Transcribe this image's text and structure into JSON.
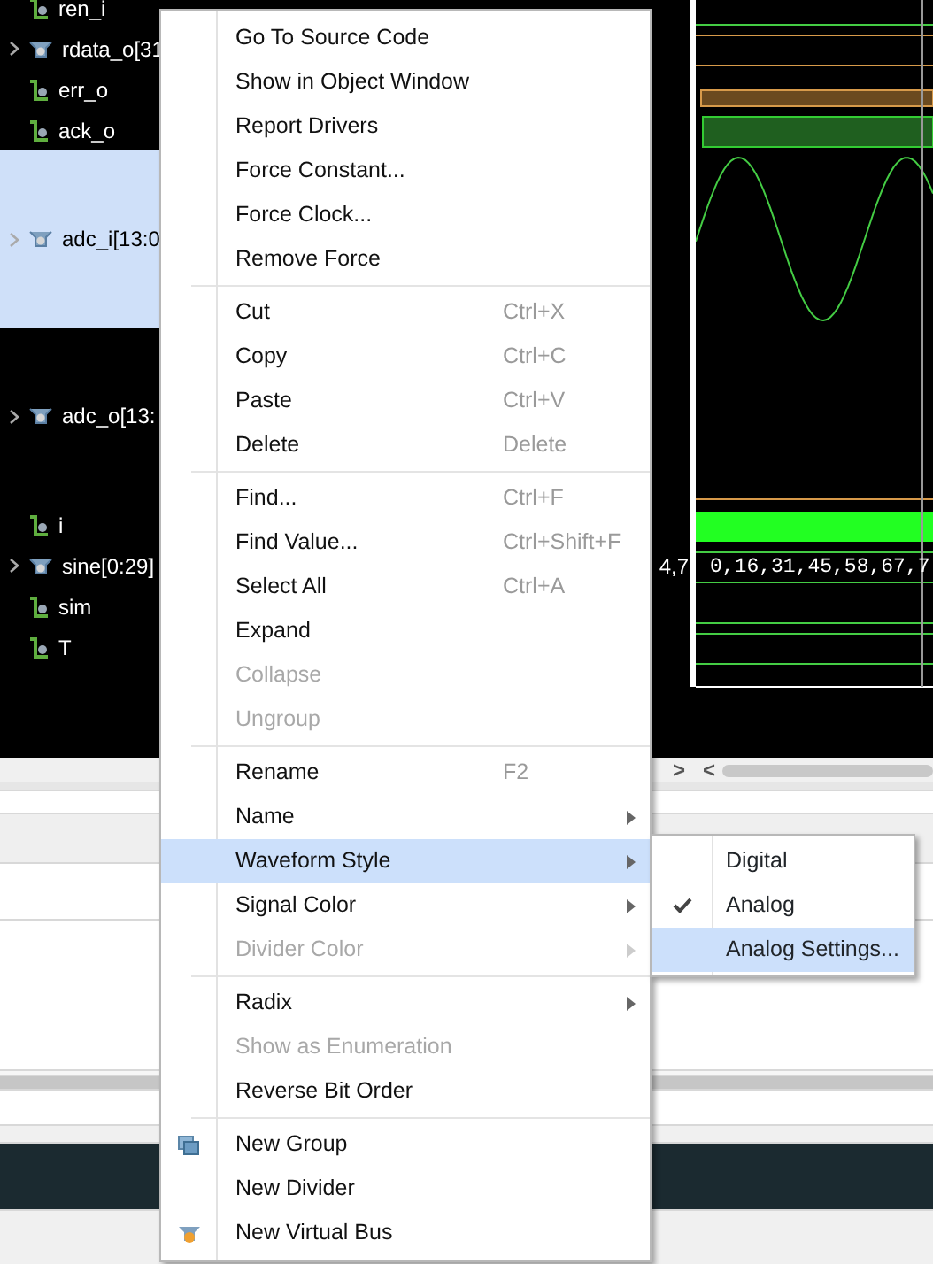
{
  "signals": [
    {
      "name": "ren_i",
      "kind": "bit",
      "expandable": false,
      "selected": false
    },
    {
      "name": "rdata_o[31",
      "kind": "bus",
      "expandable": true,
      "selected": false
    },
    {
      "name": "err_o",
      "kind": "bit",
      "expandable": false,
      "selected": false
    },
    {
      "name": "ack_o",
      "kind": "bit",
      "expandable": false,
      "selected": false
    },
    {
      "name": "adc_i[13:0",
      "kind": "analog",
      "expandable": true,
      "selected": true
    },
    {
      "name": "adc_o[13:",
      "kind": "analog",
      "expandable": true,
      "selected": false
    },
    {
      "name": "i",
      "kind": "bit",
      "expandable": false,
      "selected": false
    },
    {
      "name": "sine[0:29]",
      "kind": "bus",
      "expandable": true,
      "selected": false,
      "value": "4,7",
      "wave_text": "0,16,31,45,58,67,7"
    },
    {
      "name": "sim",
      "kind": "bit",
      "expandable": false,
      "selected": false
    },
    {
      "name": "T",
      "kind": "bit",
      "expandable": false,
      "selected": false
    }
  ],
  "scroll": {
    "left": ">",
    "right": "<"
  },
  "menu": [
    {
      "kind": "item",
      "label": "Go To Source Code",
      "disabled": false,
      "submenu": false,
      "selected": false
    },
    {
      "kind": "item",
      "label": "Show in Object Window",
      "disabled": false,
      "submenu": false,
      "selected": false
    },
    {
      "kind": "item",
      "label": "Report Drivers",
      "disabled": false,
      "submenu": false,
      "selected": false
    },
    {
      "kind": "item",
      "label": "Force Constant...",
      "disabled": false,
      "submenu": false,
      "selected": false
    },
    {
      "kind": "item",
      "label": "Force Clock...",
      "disabled": false,
      "submenu": false,
      "selected": false
    },
    {
      "kind": "item",
      "label": "Remove Force",
      "disabled": false,
      "submenu": false,
      "selected": false
    },
    {
      "kind": "separator"
    },
    {
      "kind": "item",
      "label": "Cut",
      "shortcut": "Ctrl+X",
      "disabled": false,
      "submenu": false,
      "selected": false
    },
    {
      "kind": "item",
      "label": "Copy",
      "shortcut": "Ctrl+C",
      "disabled": false,
      "submenu": false,
      "selected": false
    },
    {
      "kind": "item",
      "label": "Paste",
      "shortcut": "Ctrl+V",
      "disabled": false,
      "submenu": false,
      "selected": false
    },
    {
      "kind": "item",
      "label": "Delete",
      "shortcut": "Delete",
      "disabled": false,
      "submenu": false,
      "selected": false
    },
    {
      "kind": "separator"
    },
    {
      "kind": "item",
      "label": "Find...",
      "shortcut": "Ctrl+F",
      "disabled": false,
      "submenu": false,
      "selected": false
    },
    {
      "kind": "item",
      "label": "Find Value...",
      "shortcut": "Ctrl+Shift+F",
      "disabled": false,
      "submenu": false,
      "selected": false
    },
    {
      "kind": "item",
      "label": "Select All",
      "shortcut": "Ctrl+A",
      "disabled": false,
      "submenu": false,
      "selected": false
    },
    {
      "kind": "item",
      "label": "Expand",
      "disabled": false,
      "submenu": false,
      "selected": false
    },
    {
      "kind": "item",
      "label": "Collapse",
      "disabled": true,
      "submenu": false,
      "selected": false
    },
    {
      "kind": "item",
      "label": "Ungroup",
      "disabled": true,
      "submenu": false,
      "selected": false
    },
    {
      "kind": "separator"
    },
    {
      "kind": "item",
      "label": "Rename",
      "shortcut": "F2",
      "disabled": false,
      "submenu": false,
      "selected": false
    },
    {
      "kind": "item",
      "label": "Name",
      "disabled": false,
      "submenu": true,
      "selected": false
    },
    {
      "kind": "item",
      "label": "Waveform Style",
      "disabled": false,
      "submenu": true,
      "selected": true
    },
    {
      "kind": "item",
      "label": "Signal Color",
      "disabled": false,
      "submenu": true,
      "selected": false
    },
    {
      "kind": "item",
      "label": "Divider Color",
      "disabled": true,
      "submenu": true,
      "selected": false
    },
    {
      "kind": "separator"
    },
    {
      "kind": "item",
      "label": "Radix",
      "disabled": false,
      "submenu": true,
      "selected": false
    },
    {
      "kind": "item",
      "label": "Show as Enumeration",
      "disabled": true,
      "submenu": false,
      "selected": false
    },
    {
      "kind": "item",
      "label": "Reverse Bit Order",
      "disabled": false,
      "submenu": false,
      "selected": false
    },
    {
      "kind": "separator"
    },
    {
      "kind": "group-item",
      "label": "New Group",
      "disabled": false,
      "submenu": false,
      "selected": false
    },
    {
      "kind": "item",
      "label": "New Divider",
      "disabled": false,
      "submenu": false,
      "selected": false
    },
    {
      "kind": "bus-item",
      "label": "New Virtual Bus",
      "disabled": false,
      "submenu": false,
      "selected": false
    }
  ],
  "submenu": [
    {
      "label": "Digital",
      "checked": false,
      "selected": false
    },
    {
      "label": "Analog",
      "checked": true,
      "selected": false
    },
    {
      "label": "Analog Settings...",
      "checked": false,
      "selected": true
    }
  ]
}
